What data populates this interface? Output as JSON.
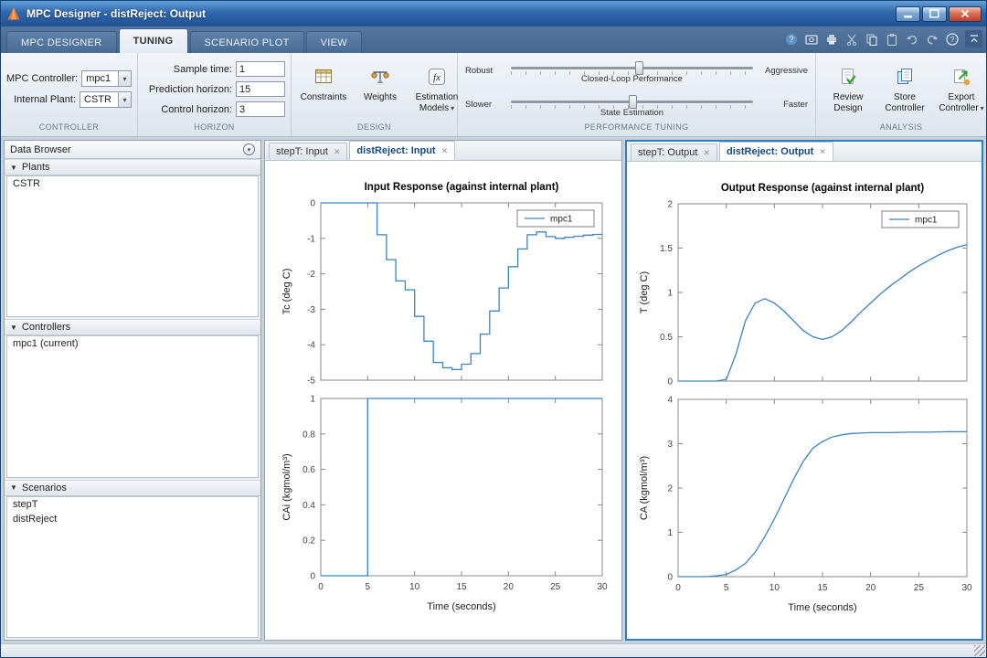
{
  "colors": {
    "titlebar": "#2f67ad",
    "focus_border": "#2e7ec2",
    "plot_line": "#3f83bd"
  },
  "icons": {
    "close": "✕",
    "caret_down": "▾",
    "section_triangle": "▼",
    "browser_button": "▾",
    "help": "?",
    "fx": "fx"
  },
  "window": {
    "title": "MPC Designer - distReject: Output"
  },
  "ribbon": {
    "tabs": [
      {
        "label": "MPC DESIGNER",
        "active": false
      },
      {
        "label": "TUNING",
        "active": true
      },
      {
        "label": "SCENARIO PLOT",
        "active": false
      },
      {
        "label": "VIEW",
        "active": false
      }
    ],
    "controller": {
      "section_label": "CONTROLLER",
      "mpc_controller_label": "MPC Controller:",
      "mpc_controller_value": "mpc1",
      "internal_plant_label": "Internal Plant:",
      "internal_plant_value": "CSTR"
    },
    "horizon": {
      "section_label": "HORIZON",
      "sample_time_label": "Sample time:",
      "sample_time_value": "1",
      "prediction_horizon_label": "Prediction horizon:",
      "prediction_horizon_value": "15",
      "control_horizon_label": "Control horizon:",
      "control_horizon_value": "3"
    },
    "design": {
      "section_label": "DESIGN",
      "constraints_label": "Constraints",
      "weights_label": "Weights",
      "estimation_models_label": "Estimation Models"
    },
    "performance": {
      "section_label": "PERFORMANCE TUNING",
      "slider1": {
        "left_label": "Robust",
        "center_label": "Closed-Loop Performance",
        "right_label": "Aggressive",
        "position": 53
      },
      "slider2": {
        "left_label": "Slower",
        "center_label": "State Estimation",
        "right_label": "Faster",
        "position": 50
      }
    },
    "analysis": {
      "section_label": "ANALYSIS",
      "review_design_label": "Review Design",
      "store_controller_label": "Store Controller",
      "export_controller_label": "Export Controller"
    }
  },
  "data_browser": {
    "title": "Data Browser",
    "plants": {
      "title": "Plants",
      "items": [
        "CSTR"
      ]
    },
    "controllers": {
      "title": "Controllers",
      "items": [
        "mpc1 (current)"
      ]
    },
    "scenarios": {
      "title": "Scenarios",
      "items": [
        "stepT",
        "distReject"
      ]
    }
  },
  "input_doc": {
    "tabs": [
      {
        "label": "stepT: Input",
        "active": false
      },
      {
        "label": "distReject: Input",
        "active": true
      }
    ]
  },
  "output_doc": {
    "tabs": [
      {
        "label": "stepT: Output",
        "active": false
      },
      {
        "label": "distReject: Output",
        "active": true
      }
    ]
  },
  "chart_data": [
    {
      "id": "input-response-top",
      "type": "step",
      "title": "Input Response (against internal plant)",
      "ylabel": "Tc (deg C)",
      "xlabel": "",
      "xlim": [
        0,
        30
      ],
      "ylim": [
        -5,
        0
      ],
      "xticks": [
        0,
        5,
        10,
        15,
        20,
        25,
        30
      ],
      "yticks": [
        0,
        -1,
        -2,
        -3,
        -4,
        -5
      ],
      "show_xticklabels": false,
      "legend": [
        "mpc1"
      ],
      "x": [
        0,
        1,
        2,
        3,
        4,
        5,
        6,
        7,
        8,
        9,
        10,
        11,
        12,
        13,
        14,
        15,
        16,
        17,
        18,
        19,
        20,
        21,
        22,
        23,
        24,
        25,
        26,
        27,
        28,
        29,
        30
      ],
      "y": [
        0,
        0,
        0,
        0,
        0,
        0,
        -0.9,
        -1.6,
        -2.2,
        -2.45,
        -3.2,
        -3.9,
        -4.5,
        -4.65,
        -4.7,
        -4.55,
        -4.25,
        -3.7,
        -3.05,
        -2.4,
        -1.8,
        -1.3,
        -0.9,
        -0.82,
        -0.95,
        -1.0,
        -0.97,
        -0.94,
        -0.91,
        -0.89,
        -0.87
      ]
    },
    {
      "id": "input-response-bottom",
      "type": "line",
      "title": "",
      "ylabel": "CAi (kgmol/m³)",
      "xlabel": "Time (seconds)",
      "xlim": [
        0,
        30
      ],
      "ylim": [
        0,
        1
      ],
      "xticks": [
        0,
        5,
        10,
        15,
        20,
        25,
        30
      ],
      "yticks": [
        0,
        0.2,
        0.4,
        0.6,
        0.8,
        1
      ],
      "show_xticklabels": true,
      "x": [
        0,
        5,
        5,
        30
      ],
      "y": [
        0,
        0,
        1,
        1
      ]
    },
    {
      "id": "output-response-top",
      "type": "line",
      "title": "Output Response (against internal plant)",
      "ylabel": "T (deg C)",
      "xlabel": "",
      "xlim": [
        0,
        30
      ],
      "ylim": [
        0,
        2
      ],
      "xticks": [
        0,
        5,
        10,
        15,
        20,
        25,
        30
      ],
      "yticks": [
        0,
        0.5,
        1,
        1.5,
        2
      ],
      "show_xticklabels": false,
      "legend": [
        "mpc1"
      ],
      "x": [
        0,
        1,
        2,
        3,
        4,
        5,
        6,
        7,
        8,
        9,
        10,
        11,
        12,
        13,
        14,
        15,
        16,
        17,
        18,
        19,
        20,
        21,
        22,
        23,
        24,
        25,
        26,
        27,
        28,
        29,
        30
      ],
      "y": [
        0,
        0,
        0,
        0,
        0,
        0.02,
        0.3,
        0.68,
        0.88,
        0.93,
        0.88,
        0.79,
        0.68,
        0.57,
        0.5,
        0.47,
        0.5,
        0.57,
        0.67,
        0.78,
        0.88,
        0.98,
        1.07,
        1.15,
        1.23,
        1.3,
        1.36,
        1.42,
        1.47,
        1.51,
        1.54
      ]
    },
    {
      "id": "output-response-bottom",
      "type": "line",
      "title": "",
      "ylabel": "CA (kgmol/m³)",
      "xlabel": "Time (seconds)",
      "xlim": [
        0,
        30
      ],
      "ylim": [
        0,
        4
      ],
      "xticks": [
        0,
        5,
        10,
        15,
        20,
        25,
        30
      ],
      "yticks": [
        0,
        1,
        2,
        3,
        4
      ],
      "show_xticklabels": true,
      "x": [
        0,
        1,
        2,
        3,
        4,
        5,
        6,
        7,
        8,
        9,
        10,
        11,
        12,
        13,
        14,
        15,
        16,
        17,
        18,
        19,
        20,
        22,
        24,
        26,
        28,
        30
      ],
      "y": [
        0,
        0,
        0,
        0,
        0.02,
        0.05,
        0.15,
        0.3,
        0.55,
        0.9,
        1.3,
        1.75,
        2.2,
        2.6,
        2.9,
        3.05,
        3.15,
        3.2,
        3.23,
        3.24,
        3.25,
        3.25,
        3.26,
        3.26,
        3.27,
        3.27
      ]
    }
  ]
}
